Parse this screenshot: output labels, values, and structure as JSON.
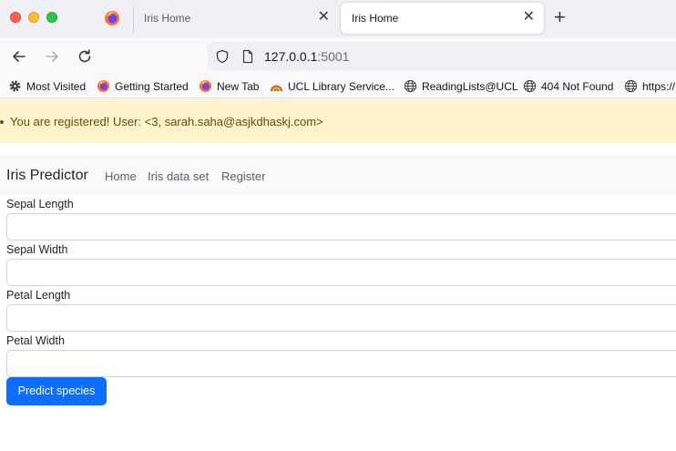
{
  "browser": {
    "tabs": [
      {
        "title": "Iris Home",
        "active": false
      },
      {
        "title": "Iris Home",
        "active": true
      }
    ],
    "tab_close_glyph": "✕",
    "new_tab_glyph": "+",
    "url": {
      "host": "127.0.0.1",
      "port": ":5001"
    },
    "bookmarks": [
      {
        "label": "Most Visited",
        "icon": "gear-icon"
      },
      {
        "label": "Getting Started",
        "icon": "firefox-icon"
      },
      {
        "label": "New Tab",
        "icon": "firefox-icon"
      },
      {
        "label": "UCL Library Service...",
        "icon": "rainbow-icon"
      },
      {
        "label": "ReadingLists@UCL",
        "icon": "globe-icon"
      },
      {
        "label": "404 Not Found",
        "icon": "globe-icon"
      },
      {
        "label": "https://",
        "icon": "globe-icon"
      }
    ]
  },
  "page": {
    "flash_message": "You are registered! User: <3, sarah.saha@asjkdhaskj.com>",
    "navbar": {
      "brand": "Iris Predictor",
      "links": [
        "Home",
        "Iris data set",
        "Register"
      ]
    },
    "form": {
      "fields": [
        {
          "label": "Sepal Length",
          "value": ""
        },
        {
          "label": "Sepal Width",
          "value": ""
        },
        {
          "label": "Petal Length",
          "value": ""
        },
        {
          "label": "Petal Width",
          "value": ""
        }
      ],
      "submit_label": "Predict species"
    }
  },
  "colors": {
    "alert_bg": "#fff3cd",
    "alert_text": "#664d03",
    "primary": "#0d6efd",
    "navbar_bg": "#f8f9fa"
  }
}
